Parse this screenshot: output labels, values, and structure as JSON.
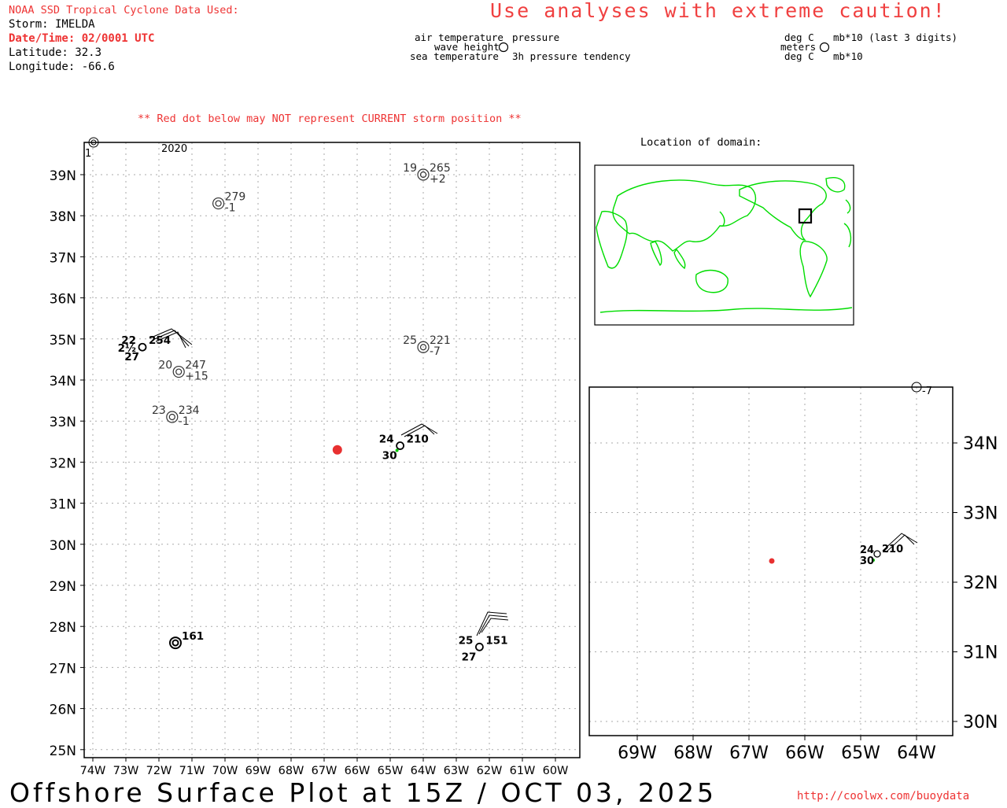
{
  "header": {
    "source_line": "NOAA SSD Tropical Cyclone Data Used:",
    "storm": "Storm: IMELDA",
    "datetime": "Date/Time: 02/0001 UTC",
    "latitude": "Latitude: 32.3",
    "longitude": "Longitude: -66.6",
    "caution": "Use analyses with extreme caution!"
  },
  "legend": {
    "air_temperature": "air temperature",
    "wave_height": "wave height",
    "sea_temperature": "sea temperature",
    "pressure": "pressure",
    "pressure_tendency": "3h pressure tendency",
    "unit_deg_top": "deg C",
    "unit_meters": "meters",
    "unit_deg_bottom": "deg C",
    "unit_mb_top": "mb*10 (last 3 digits)",
    "unit_mb_bottom": "mb*10"
  },
  "notice": "** Red dot below may NOT represent CURRENT storm position **",
  "location_title": "Location of domain:",
  "main_map": {
    "lat_labels": [
      "39N",
      "38N",
      "37N",
      "36N",
      "35N",
      "34N",
      "33N",
      "32N",
      "31N",
      "30N",
      "29N",
      "28N",
      "27N",
      "26N",
      "25N"
    ],
    "lon_labels": [
      "74W",
      "73W",
      "72W",
      "71W",
      "70W",
      "69W",
      "68W",
      "67W",
      "66W",
      "65W",
      "64W",
      "63W",
      "62W",
      "61W",
      "60W"
    ],
    "storm_position": {
      "lat": 32.3,
      "lon": -66.6
    },
    "stations": [
      {
        "lon": -71.6,
        "lat": 33.1,
        "temp": "23",
        "pres": "234",
        "tend": "-1",
        "style": "double"
      },
      {
        "lon": -71.4,
        "lat": 34.2,
        "temp": "20",
        "pres": "247",
        "tend": "+15",
        "style": "double"
      },
      {
        "lon": -70.2,
        "lat": 38.3,
        "temp": "",
        "pres": "279",
        "tend": "-1",
        "style": "double"
      },
      {
        "lon": -64.0,
        "lat": 39.0,
        "temp": "19",
        "pres": "265",
        "tend": "+2",
        "style": "double"
      },
      {
        "lon": -64.0,
        "lat": 34.8,
        "temp": "25",
        "pres": "221",
        "tend": "-7",
        "style": "double"
      },
      {
        "lon": -72.5,
        "lat": 34.8,
        "temp": "22",
        "pres": "254",
        "wave": "2½",
        "sst": "27",
        "style": "bold"
      },
      {
        "lon": -64.7,
        "lat": 32.4,
        "temp": "24",
        "pres": "210",
        "sst": "30",
        "style": "bold"
      },
      {
        "lon": -71.5,
        "lat": 27.6,
        "temp": "",
        "pres": "161",
        "style": "boldDouble"
      },
      {
        "lon": -62.3,
        "lat": 27.5,
        "temp": "25",
        "pres": "151",
        "sst": "27",
        "style": "bold"
      }
    ],
    "edge_fragments": {
      "top_left": "1",
      "top_mid": "2020"
    }
  },
  "inset_map": {
    "lat_labels": [
      "34N",
      "33N",
      "32N",
      "31N",
      "30N"
    ],
    "lon_labels": [
      "69W",
      "68W",
      "67W",
      "66W",
      "65W",
      "64W"
    ],
    "station": {
      "temp": "24",
      "pres": "210",
      "sst": "30"
    },
    "edge_fragment": "-7"
  },
  "footer": {
    "title": "Offshore Surface Plot at 15Z / OCT 03, 2025",
    "url": "http://coolwx.com/buoydata"
  },
  "colors": {
    "caution": "#f04040",
    "storm_dot": "#e83030",
    "coastline": "#00dd00",
    "grid": "#aaaaaa"
  }
}
